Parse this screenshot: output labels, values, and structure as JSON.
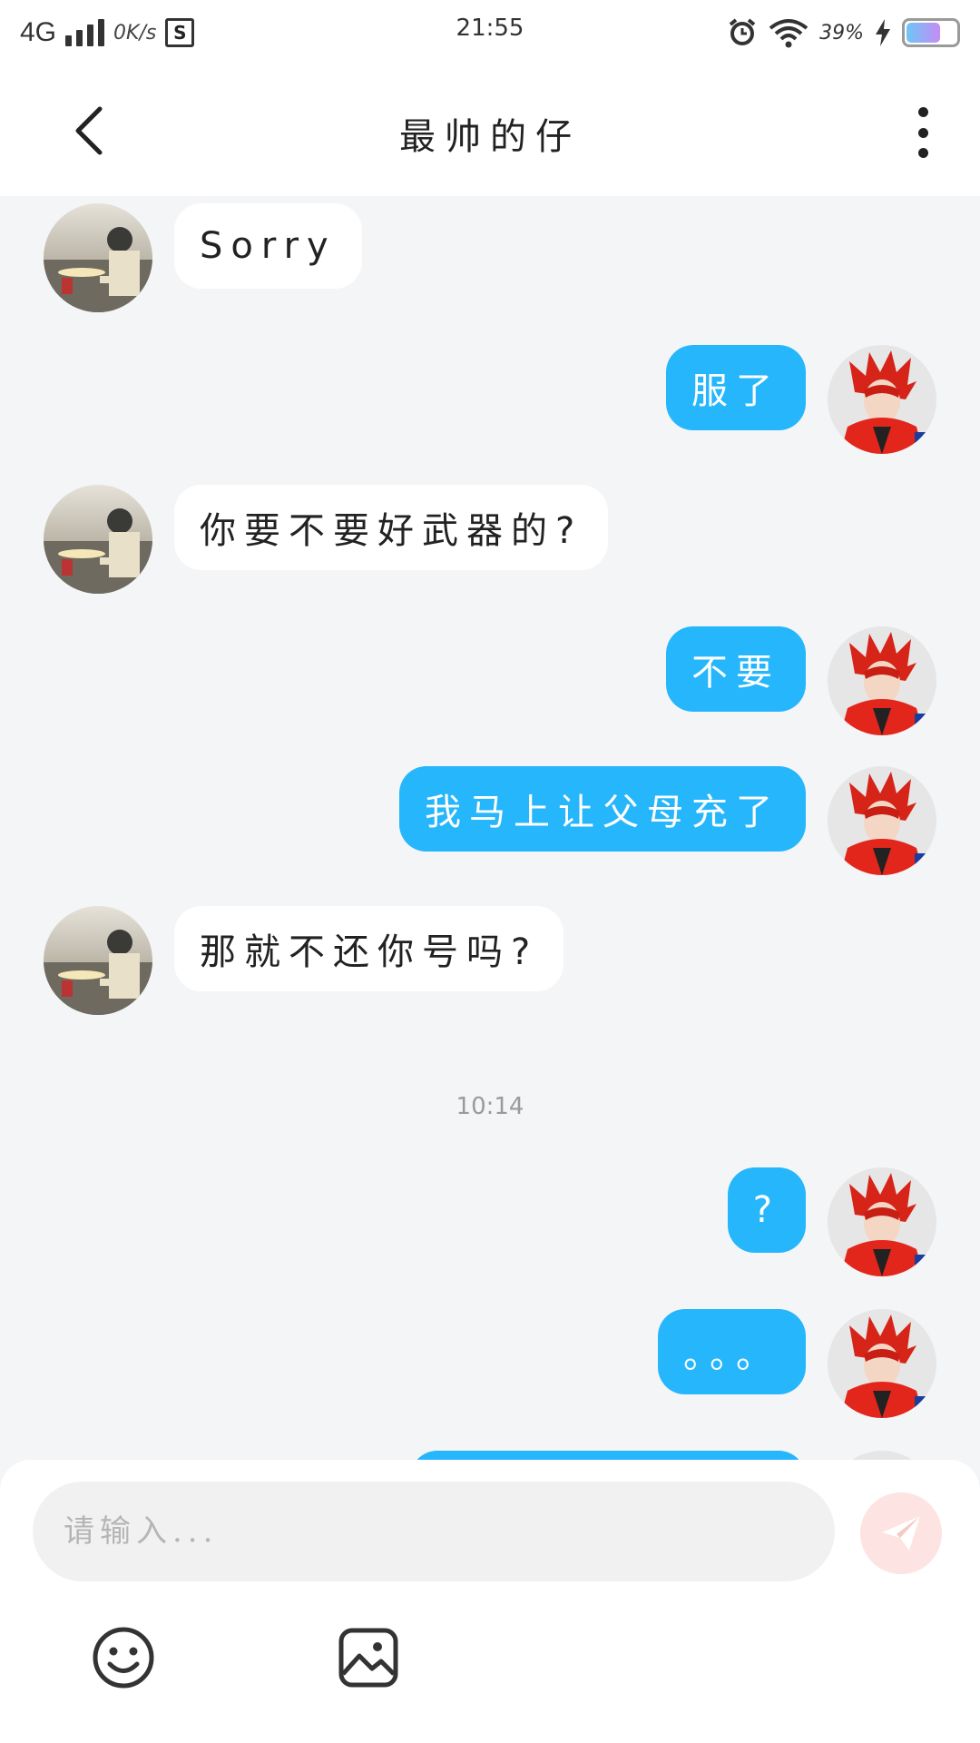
{
  "status_bar": {
    "network": "4G",
    "speed": "0K/s",
    "s_badge": "S",
    "time": "21:55",
    "battery_percent": "39%",
    "battery_level": 0.39
  },
  "header": {
    "title": "最帅的仔"
  },
  "messages": [
    {
      "side": "other",
      "text": "Sorry"
    },
    {
      "side": "me",
      "text": "服了"
    },
    {
      "side": "other",
      "text": "你要不要好武器的?"
    },
    {
      "side": "me",
      "text": "不要"
    },
    {
      "side": "me",
      "text": "我马上让父母充了"
    },
    {
      "side": "other",
      "text": "那就不还你号吗?"
    },
    {
      "side": "me",
      "text": "?"
    },
    {
      "side": "me",
      "text": "。。。"
    }
  ],
  "timestamp": "10:14",
  "composer": {
    "placeholder": "请输入..."
  },
  "colors": {
    "my_bubble": "#26b6fb",
    "other_bubble": "#ffffff",
    "background": "#f4f5f7",
    "send_button": "#fde3e1"
  }
}
